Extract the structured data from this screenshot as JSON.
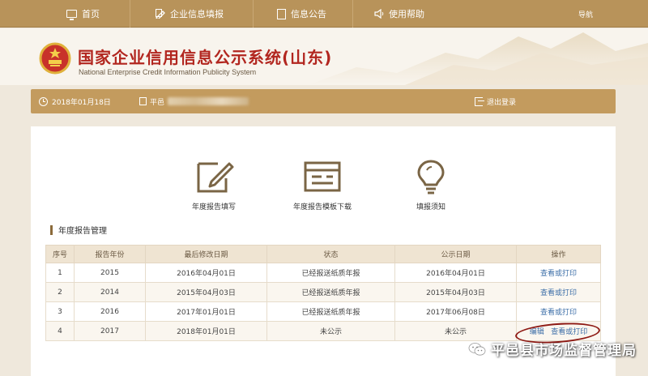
{
  "nav": {
    "items": [
      {
        "label": "首页",
        "icon": "home-icon"
      },
      {
        "label": "企业信息填报",
        "icon": "enterprise-icon"
      },
      {
        "label": "信息公告",
        "icon": "notice-icon"
      },
      {
        "label": "使用帮助",
        "icon": "help-icon"
      }
    ],
    "guide": "导航"
  },
  "header": {
    "title": "国家企业信用信息公示系统(山东)",
    "subtitle": "National Enterprise Credit Information Publicity System"
  },
  "infobar": {
    "date": "2018年01月18日",
    "enterprise_prefix": "平邑",
    "logout": "退出登录"
  },
  "features": [
    {
      "label": "年度报告填写",
      "icon": "edit-report-icon"
    },
    {
      "label": "年度报告模板下载",
      "icon": "template-download-icon"
    },
    {
      "label": "填报须知",
      "icon": "lightbulb-icon"
    }
  ],
  "section_title": "年度报告管理",
  "table": {
    "headers": [
      "序号",
      "报告年份",
      "最后修改日期",
      "状态",
      "公示日期",
      "操作"
    ],
    "rows": [
      {
        "no": "1",
        "year": "2015",
        "modified": "2016年04月01日",
        "status": "已经报送纸质年报",
        "published": "2016年04月01日",
        "actions": [
          "查看或打印"
        ]
      },
      {
        "no": "2",
        "year": "2014",
        "modified": "2015年04月03日",
        "status": "已经报送纸质年报",
        "published": "2015年04月03日",
        "actions": [
          "查看或打印"
        ]
      },
      {
        "no": "3",
        "year": "2016",
        "modified": "2017年01月01日",
        "status": "已经报送纸质年报",
        "published": "2017年06月08日",
        "actions": [
          "查看或打印"
        ]
      },
      {
        "no": "4",
        "year": "2017",
        "modified": "2018年01月01日",
        "status": "未公示",
        "published": "未公示",
        "actions": [
          "编辑",
          "查看或打印"
        ]
      }
    ]
  },
  "watermark": "平邑县市场监督管理局",
  "colors": {
    "nav_bg": "#b8935a",
    "infobar_bg": "#c39b5e",
    "title_red": "#b2261f",
    "link_blue": "#3d6fa8",
    "annotation_red": "#8e1a14"
  }
}
